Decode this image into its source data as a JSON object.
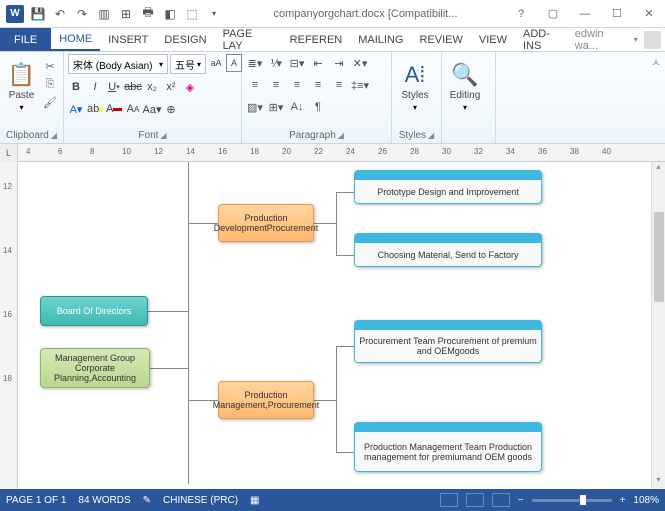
{
  "titlebar": {
    "doc_name": "companyorgchart.docx [Compatibilit..."
  },
  "tabs": {
    "file": "FILE",
    "home": "HOME",
    "insert": "INSERT",
    "design": "DESIGN",
    "pagelayout": "PAGE LAY",
    "references": "REFEREN",
    "mailings": "MAILING",
    "review": "REVIEW",
    "view": "VIEW",
    "addins": "ADD-INS",
    "user": "edwin wa..."
  },
  "ribbon": {
    "clipboard": {
      "label": "Clipboard",
      "paste": "Paste"
    },
    "font": {
      "label": "Font",
      "name": "宋体 (Body Asian)",
      "size": "五号"
    },
    "paragraph": {
      "label": "Paragraph"
    },
    "styles": {
      "label": "Styles",
      "btn": "Styles"
    },
    "editing": {
      "label": "Editing",
      "btn": "Editing"
    }
  },
  "ruler": {
    "h": [
      "4",
      "6",
      "8",
      "10",
      "12",
      "14",
      "16",
      "18",
      "20",
      "22",
      "24",
      "26",
      "28",
      "30",
      "32",
      "34",
      "36",
      "38",
      "40"
    ],
    "v": [
      "12",
      "14",
      "16",
      "18"
    ]
  },
  "org": {
    "n1": "Board Of Directors",
    "n2": "Management Group Corporate Planning,Accounting",
    "n3": "Production DevelopmentProcurement",
    "n4": "Production Management,Procurement",
    "n5": "Prototype Design and Improvement",
    "n6": "Choosing Material, Send to Factory",
    "n7": "Procurement Team Procurement of premium and OEMgoods",
    "n8": "Production Management Team Production management for premiumand OEM goods"
  },
  "status": {
    "page": "PAGE 1 OF 1",
    "words": "84 WORDS",
    "lang": "CHINESE (PRC)",
    "zoom": "108%"
  }
}
